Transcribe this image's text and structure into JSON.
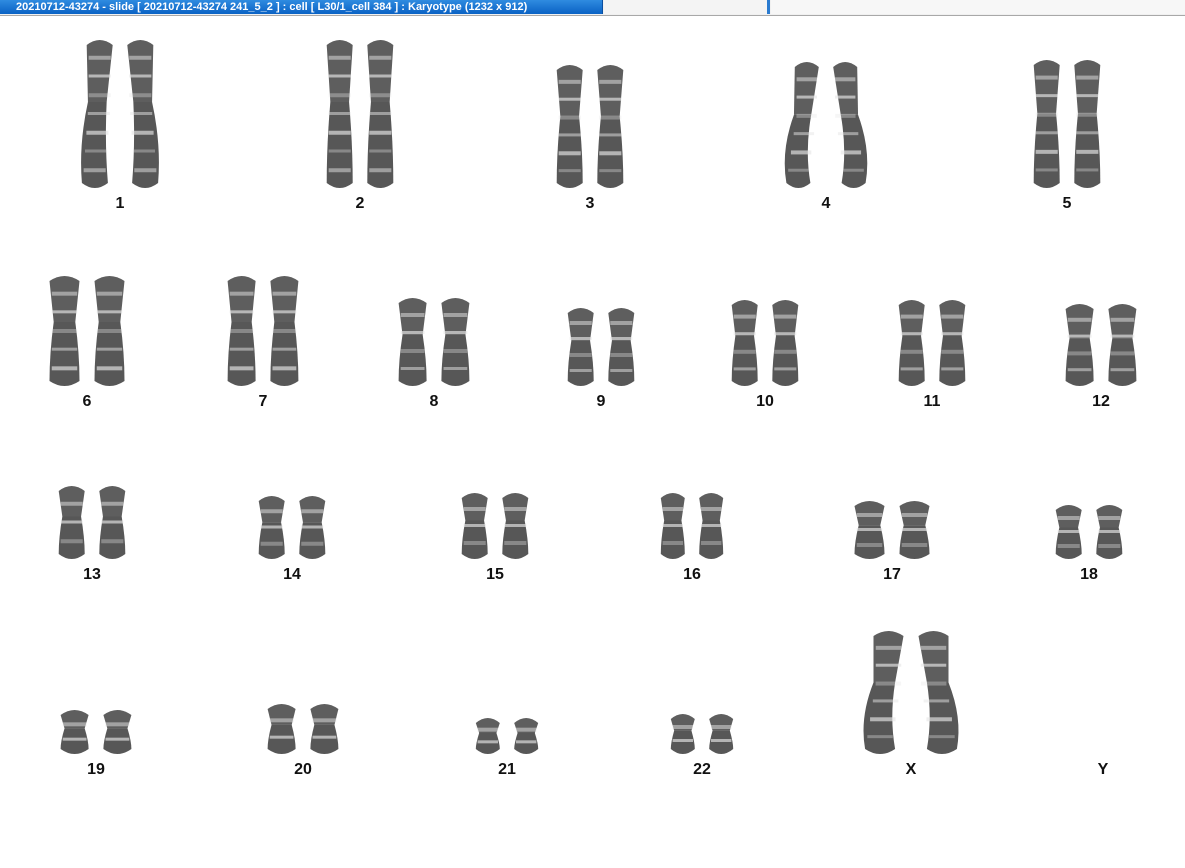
{
  "window": {
    "title": "20210712-43274 - slide [ 20210712-43274 241_5_2 ] : cell [ L30/1_cell 384 ] : Karyotype  (1232 x 912)"
  },
  "karyotype": {
    "chromosome_color": "#3a3a3a",
    "pairs": [
      {
        "label": "1"
      },
      {
        "label": "2"
      },
      {
        "label": "3"
      },
      {
        "label": "4"
      },
      {
        "label": "5"
      },
      {
        "label": "6"
      },
      {
        "label": "7"
      },
      {
        "label": "8"
      },
      {
        "label": "9"
      },
      {
        "label": "10"
      },
      {
        "label": "11"
      },
      {
        "label": "12"
      },
      {
        "label": "13"
      },
      {
        "label": "14"
      },
      {
        "label": "15"
      },
      {
        "label": "16"
      },
      {
        "label": "17"
      },
      {
        "label": "18"
      },
      {
        "label": "19"
      },
      {
        "label": "20"
      },
      {
        "label": "21"
      },
      {
        "label": "22"
      },
      {
        "label": "X"
      },
      {
        "label": "Y"
      }
    ]
  }
}
